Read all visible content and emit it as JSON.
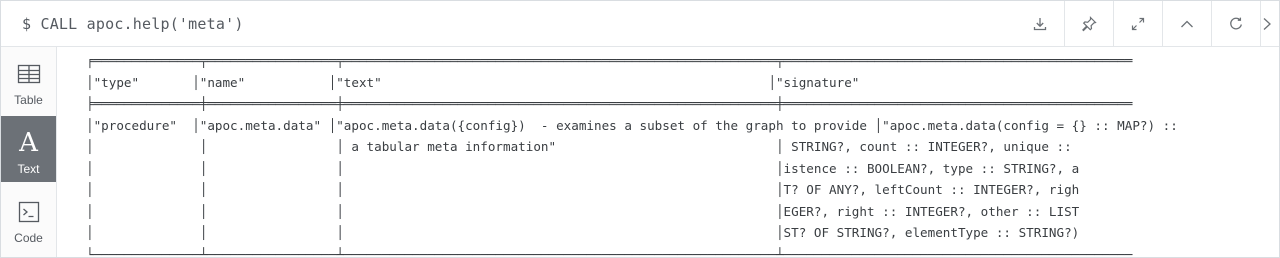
{
  "query": {
    "prompt": "$",
    "text": "CALL apoc.help('meta')"
  },
  "toolbar": {
    "icons": [
      "download-icon",
      "pin-icon",
      "expand-icon",
      "collapse-up-icon",
      "rerun-icon",
      "close-icon"
    ]
  },
  "sidebar": {
    "items": [
      {
        "label": "Table",
        "icon": "table-icon"
      },
      {
        "label": "Text",
        "icon": "text-icon",
        "glyph": "A",
        "active": true
      },
      {
        "label": "Code",
        "icon": "code-icon"
      }
    ]
  },
  "result": {
    "separator": "╒══════════════╤═════════════════╤═════════════════════════════════════════════════════════╤══════════════════════════════════════════════",
    "header_row": "│\"type\"       │\"name\"           │\"text\"                                                   │\"signature\"",
    "header_separator": "╞══════════════╪═════════════════╪═════════════════════════════════════════════════════════╪══════════════════════════════════════════════",
    "rows": [
      "│\"procedure\"  │\"apoc.meta.data\" │\"apoc.meta.data({config})  - examines a subset of the graph to provide │\"apoc.meta.data(config = {} :: MAP?) ::",
      "│              │                 │ a tabular meta information\"                             │ STRING?, count :: INTEGER?, unique ::",
      "│              │                 │                                                         │istence :: BOOLEAN?, type :: STRING?, a",
      "│              │                 │                                                         │T? OF ANY?, leftCount :: INTEGER?, righ",
      "│              │                 │                                                         │EGER?, right :: INTEGER?, other :: LIST",
      "│              │                 │                                                         │ST? OF STRING?, elementType :: STRING?)"
    ],
    "footer_separator": "└──────────────┴─────────────────┴─────────────────────────────────────────────────────────┴──────────────────────────────────────────────"
  }
}
